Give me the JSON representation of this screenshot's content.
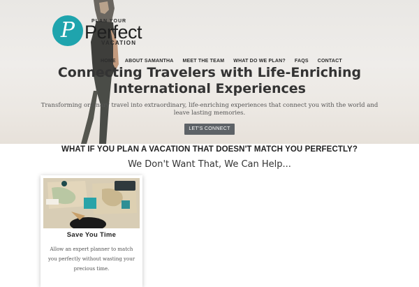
{
  "logo": {
    "top_text": "PLAN YOUR",
    "main_text": "Perfect",
    "bottom_text": "VACATION",
    "mark_letter": "P",
    "brand_color": "#1fa4ad"
  },
  "nav": {
    "items": [
      {
        "label": "HOME"
      },
      {
        "label": "ABOUT SAMANTHA"
      },
      {
        "label": "MEET THE TEAM"
      },
      {
        "label": "WHAT DO WE PLAN?"
      },
      {
        "label": "FAQS"
      },
      {
        "label": "CONTACT"
      }
    ]
  },
  "hero": {
    "title_line1": "Connecting Travelers with Life-Enriching",
    "title_line2": "International Experiences",
    "subtitle": "Transforming ordinary travel into extraordinary, life-enriching experiences that connect you with the world and leave lasting memories.",
    "cta_label": "LET'S CONNECT",
    "cta_color": "#5d6267"
  },
  "section": {
    "question": "WHAT IF YOU PLAN A VACATION THAT DOESN'T MATCH YOU PERFECTLY?",
    "tagline": "We Don't Want That, We Can Help..."
  },
  "card": {
    "title": "Save You Time",
    "text": "Allow an expert planner to match you perfectly without wasting your precious time."
  }
}
